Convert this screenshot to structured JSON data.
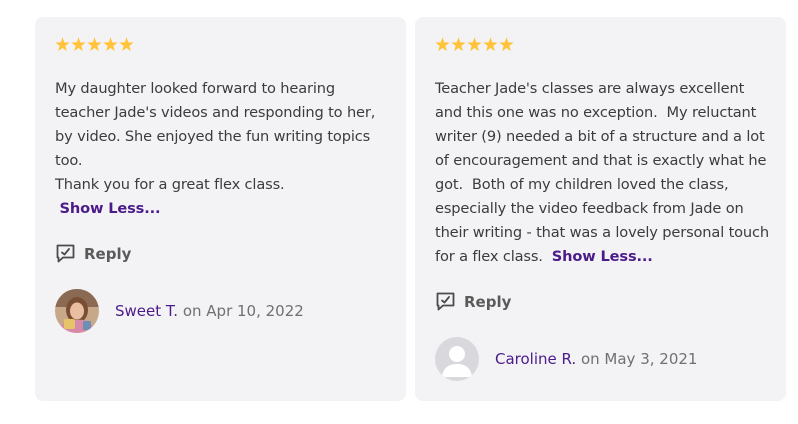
{
  "reviews": [
    {
      "rating": 5,
      "paragraphs": [
        "My daughter looked forward to hearing teacher Jade's videos and responding to her, by video. She enjoyed the fun writing topics too.",
        "Thank you for a great flex class."
      ],
      "show_less": "Show Less...",
      "reply": "Reply",
      "author": "Sweet T.",
      "date": "on Apr 10, 2022",
      "avatar": "photo"
    },
    {
      "rating": 5,
      "paragraphs": [
        "Teacher Jade's classes are always excellent and this one was no exception.  My reluctant writer (9) needed a bit of a structure and a lot of encouragement and that is exactly what he got.  Both of my children loved the class, especially the video feedback from Jade on their writing - that was a lovely personal touch for a flex class. "
      ],
      "show_less": "Show Less...",
      "reply": "Reply",
      "author": "Caroline R.",
      "date": "on May 3, 2021",
      "avatar": "default-avatar-icon"
    }
  ],
  "colors": {
    "card_bg": "#f3f3f6",
    "star": "#ffc43a",
    "link": "#4b1b8a",
    "muted": "#707070"
  }
}
